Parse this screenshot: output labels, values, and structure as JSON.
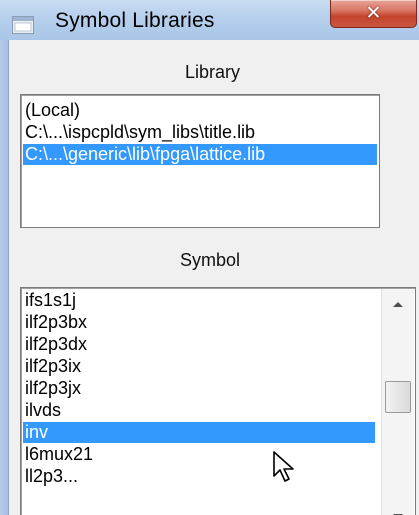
{
  "window": {
    "title": "Symbol Libraries",
    "close_label": "✕"
  },
  "library": {
    "label": "Library",
    "items": [
      "(Local)",
      "C:\\...\\ispcpld\\sym_libs\\title.lib",
      "C:\\...\\generic\\lib\\fpga\\lattice.lib"
    ],
    "selected": "C:\\...\\generic\\lib\\fpga\\lattice.lib"
  },
  "symbol": {
    "label": "Symbol",
    "items": [
      "ifs1s1j",
      "ilf2p3bx",
      "ilf2p3dx",
      "ilf2p3ix",
      "ilf2p3jx",
      "ilvds",
      "inv",
      "l6mux21",
      "ll2p3..."
    ],
    "selected": "inv"
  },
  "colors": {
    "selection": "#3399ff",
    "titlebar": "#b6cfec",
    "close_button": "#c9553f"
  },
  "icons": {
    "app": "window-icon",
    "close": "close-icon",
    "scroll_up": "arrow-up-icon",
    "scroll_down": "arrow-down-icon",
    "cursor": "mouse-pointer-icon"
  }
}
